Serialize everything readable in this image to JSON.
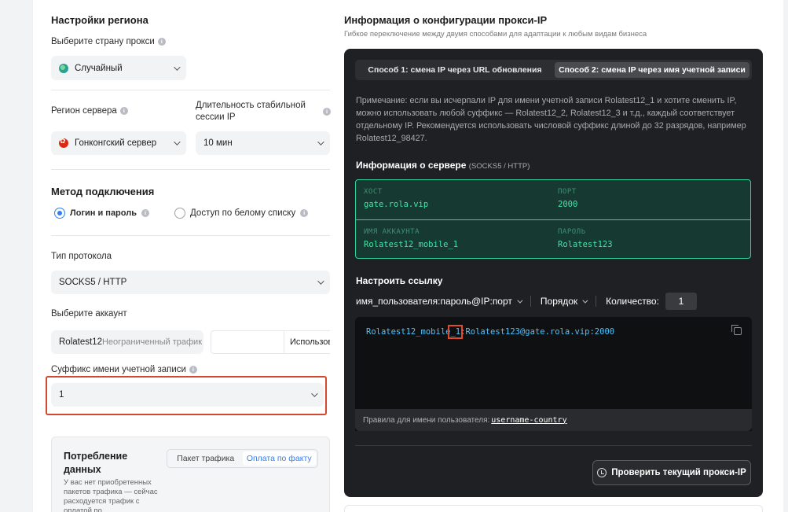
{
  "region": {
    "title": "Настройки региона",
    "country_label": "Выберите страну прокси",
    "country_value": "Случайный",
    "server_region_label": "Регион сервера",
    "server_region_value": "Гонконгский сервер",
    "session_label": "Длительность стабильной сессии IP",
    "session_value": "10 мин"
  },
  "connection": {
    "title": "Метод подключения",
    "option_login": "Логин и пароль",
    "option_whitelist": "Доступ по белому списку",
    "protocol_label": "Тип протокола",
    "protocol_value": "SOCKS5 / HTTP",
    "account_label": "Выберите аккаунт",
    "account_value": "Rolatest12",
    "account_traffic": "Неограниченный трафик",
    "account_used": "Использовано",
    "suffix_label": "Суффикс имени учетной записи",
    "suffix_value": "1"
  },
  "consumption": {
    "title": "Потребление данных",
    "desc": "У вас нет приобретенных пакетов трафика — сейчас расходуется трафик с оплатой по",
    "tab_package": "Пакет трафика",
    "tab_payg": "Оплата по факту"
  },
  "config": {
    "title": "Информация о конфигурации прокси-IP",
    "subtitle": "Гибкое переключение между двумя способами для адаптации к любым видам бизнеса",
    "method1": "Способ 1: смена IP через URL обновления",
    "method2": "Способ 2: смена IP через имя учетной записи",
    "note": "Примечание: если вы исчерпали IP для имени учетной записи Rolatest12_1 и хотите сменить IP, можно использовать любой суффикс — Rolatest12_2, Rolatest12_3 и т.д., каждый соответствует отдельному IP. Рекомендуется использовать числовой суффикс длиной до 32 разрядов, например Rolatest12_98427.",
    "server_info_title": "Информация о сервере",
    "server_info_proto": "(SOCKS5 / HTTP)",
    "host_label": "ХОСТ",
    "host_value": "gate.rola.vip",
    "port_label": "ПОРТ",
    "port_value": "2000",
    "account_label": "ИМЯ АККАУНТА",
    "account_value": "Rolatest12_mobile_1",
    "password_label": "ПАРОЛЬ",
    "password_value": "Rolatest123",
    "link_title": "Настроить ссылку",
    "format_value": "имя_пользователя:пароль@IP:порт",
    "order_label": "Порядок",
    "count_label": "Количество:",
    "count_value": "1",
    "code_prefix": "Rolatest12_mobile",
    "code_highlight": "_1",
    "code_suffix": ":Rolatest123@gate.rola.vip:2000",
    "rules_label": "Правила для имени пользователя:",
    "rules_value": "username-country",
    "check_button": "Проверить текущий прокси-IP"
  }
}
